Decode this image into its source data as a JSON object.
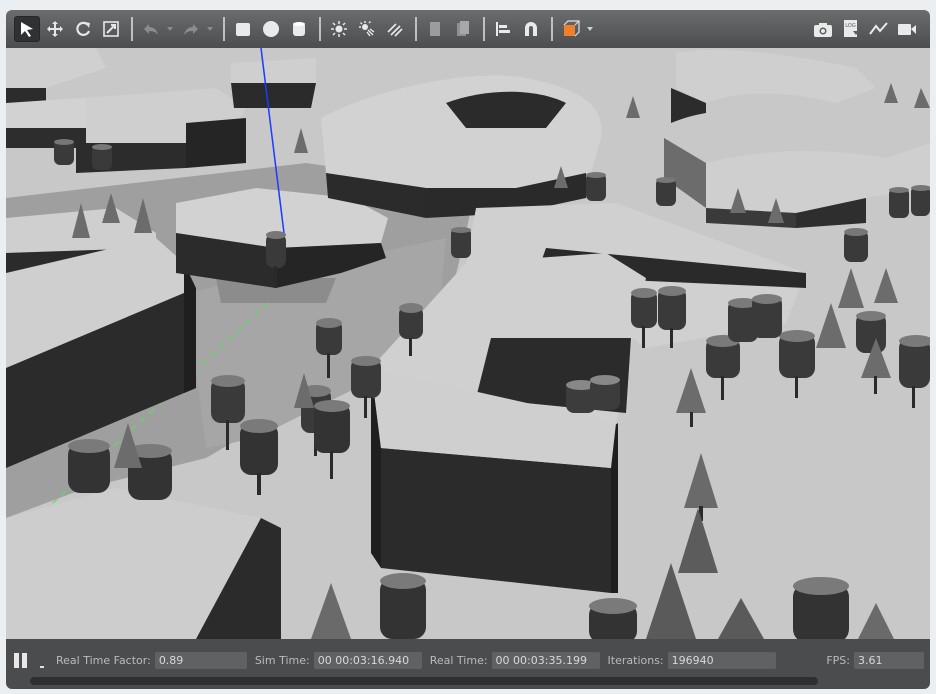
{
  "toolbar": {
    "tools": [
      {
        "icon": "select-arrow-icon",
        "active": true
      },
      {
        "icon": "translate-icon"
      },
      {
        "icon": "rotate-icon"
      },
      {
        "icon": "scale-icon"
      }
    ],
    "edit": [
      {
        "icon": "undo-icon"
      },
      {
        "icon": "redo-icon"
      }
    ],
    "shapes": [
      {
        "icon": "box-shape-icon"
      },
      {
        "icon": "sphere-shape-icon"
      },
      {
        "icon": "cylinder-shape-icon"
      }
    ],
    "lights": [
      {
        "icon": "point-light-icon"
      },
      {
        "icon": "spot-light-icon"
      },
      {
        "icon": "directional-light-icon"
      }
    ],
    "clipboard": [
      {
        "icon": "copy-icon"
      },
      {
        "icon": "paste-icon"
      }
    ],
    "align_snap": [
      {
        "icon": "align-icon"
      },
      {
        "icon": "snap-icon"
      }
    ],
    "view": [
      {
        "icon": "view-angle-icon",
        "accent": "#f0802a"
      }
    ],
    "right": [
      {
        "icon": "screenshot-camera-icon"
      },
      {
        "icon": "log-icon",
        "label": "LOG"
      },
      {
        "icon": "plot-icon"
      },
      {
        "icon": "record-video-icon"
      }
    ]
  },
  "status": {
    "real_time_factor_label": "Real Time Factor:",
    "real_time_factor_value": "0.89",
    "sim_time_label": "Sim Time:",
    "sim_time_value": "00 00:03:16.940",
    "real_time_label": "Real Time:",
    "real_time_value": "00 00:03:35.199",
    "iterations_label": "Iterations:",
    "iterations_value": "196940",
    "fps_label": "FPS:",
    "fps_value": "3.61"
  },
  "colors": {
    "toolbar_bg": "#5a5c5e",
    "statusbar_bg": "#4a4c4e",
    "ground": "#c9c9c9",
    "building_top": "#cdcdcd",
    "building_side": "#2b2b2b",
    "tree_dark": "#2e2e2e",
    "z_axis": "#1a3cff",
    "path_marker": "#3fdc3f"
  }
}
